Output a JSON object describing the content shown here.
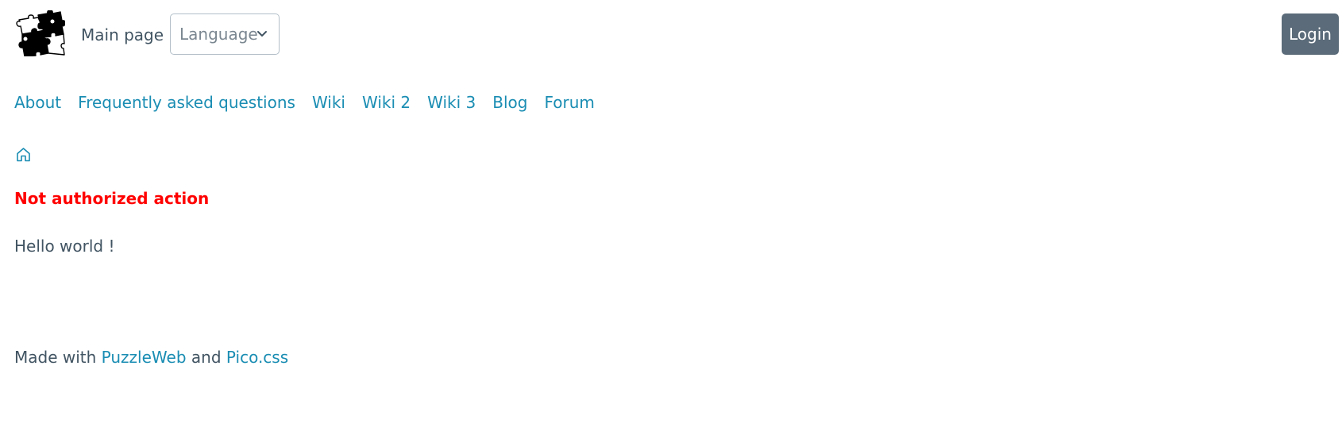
{
  "header": {
    "logo_icon": "puzzle-pieces-logo",
    "main_page_label": "Main page",
    "language_placeholder": "Language",
    "login_label": "Login"
  },
  "nav": {
    "items": [
      {
        "label": "About"
      },
      {
        "label": "Frequently asked questions"
      },
      {
        "label": "Wiki"
      },
      {
        "label": "Wiki 2"
      },
      {
        "label": "Wiki 3"
      },
      {
        "label": "Blog"
      },
      {
        "label": "Forum"
      }
    ]
  },
  "breadcrumb": {
    "home_icon": "home-icon"
  },
  "main": {
    "error_message": "Not authorized action",
    "content": "Hello world !"
  },
  "footer": {
    "made_with": "Made with",
    "puzzleweb_link": "PuzzleWeb",
    "and": "and",
    "pico_link": "Pico.css"
  },
  "colors": {
    "link": "#1a8db3",
    "text": "#415462",
    "error": "#ff0000",
    "button_bg": "#5b6b79"
  }
}
